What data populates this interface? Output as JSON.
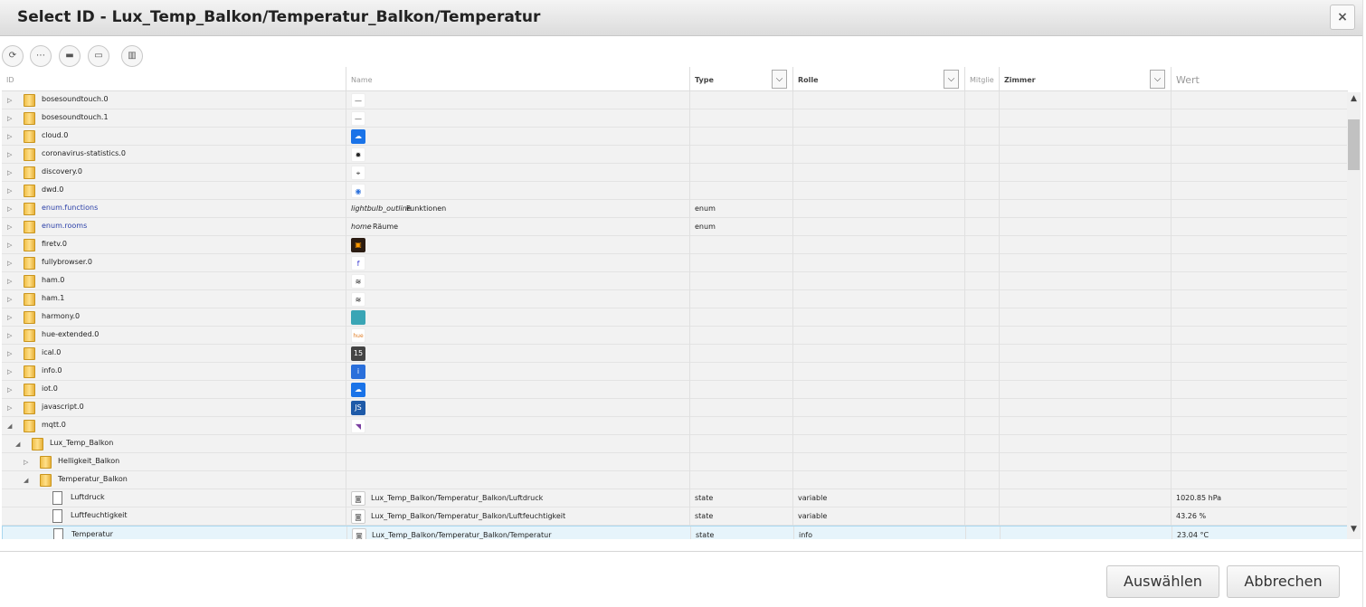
{
  "dialog": {
    "title": "Select ID - Lux_Temp_Balkon/Temperatur_Balkon/Temperatur",
    "close_label": "×",
    "select_label": "Auswählen",
    "cancel_label": "Abbrechen"
  },
  "toolbar": {
    "buttons": [
      {
        "name": "refresh-icon",
        "glyph": "⟳"
      },
      {
        "name": "list-icon",
        "glyph": "⋯"
      },
      {
        "name": "folder-collapse-icon",
        "glyph": "▬"
      },
      {
        "name": "folder-expand-icon",
        "glyph": "▭"
      },
      {
        "name": "columns-icon",
        "glyph": "▥"
      }
    ]
  },
  "columns": {
    "id": "ID",
    "name": "Name",
    "type": "Type",
    "rolle": "Rolle",
    "mitglieder": "Mitglie",
    "zimmer": "Zimmer",
    "wert": "Wert",
    "dropdown_glyph": "⌵"
  },
  "rows": [
    {
      "id": "bosesoundtouch.0",
      "level": 0,
      "kind": "folder",
      "toggle": "▷",
      "icon": {
        "bg": "#ffffff",
        "glyph": "—",
        "fg": "#444"
      }
    },
    {
      "id": "bosesoundtouch.1",
      "level": 0,
      "kind": "folder",
      "toggle": "▷",
      "icon": {
        "bg": "#ffffff",
        "glyph": "—",
        "fg": "#444"
      }
    },
    {
      "id": "cloud.0",
      "level": 0,
      "kind": "folder",
      "toggle": "▷",
      "icon": {
        "bg": "#1a73e8",
        "glyph": "☁",
        "fg": "#fff"
      }
    },
    {
      "id": "coronavirus-statistics.0",
      "level": 0,
      "kind": "folder",
      "toggle": "▷",
      "icon": {
        "bg": "#ffffff",
        "glyph": "✹",
        "fg": "#222"
      }
    },
    {
      "id": "discovery.0",
      "level": 0,
      "kind": "folder",
      "toggle": "▷",
      "icon": {
        "bg": "#ffffff",
        "glyph": "⌖",
        "fg": "#333"
      }
    },
    {
      "id": "dwd.0",
      "level": 0,
      "kind": "folder",
      "toggle": "▷",
      "icon": {
        "bg": "#ffffff",
        "glyph": "◉",
        "fg": "#2a6fdb"
      }
    },
    {
      "id": "enum.functions",
      "level": 0,
      "kind": "folder",
      "toggle": "▷",
      "enum": true,
      "name_icon": "lightbulb_outline",
      "name": "Funktionen",
      "type": "enum"
    },
    {
      "id": "enum.rooms",
      "level": 0,
      "kind": "folder",
      "toggle": "▷",
      "enum": true,
      "name_icon": "home",
      "name": "Räume",
      "type": "enum"
    },
    {
      "id": "firetv.0",
      "level": 0,
      "kind": "folder",
      "toggle": "▷",
      "icon": {
        "bg": "#2b1c12",
        "glyph": "▣",
        "fg": "#f90"
      }
    },
    {
      "id": "fullybrowser.0",
      "level": 0,
      "kind": "folder",
      "toggle": "▷",
      "icon": {
        "bg": "#ffffff",
        "glyph": "f",
        "fg": "#3a3ad0"
      }
    },
    {
      "id": "ham.0",
      "level": 0,
      "kind": "folder",
      "toggle": "▷",
      "icon": {
        "bg": "#ffffff",
        "glyph": "≋",
        "fg": "#222"
      }
    },
    {
      "id": "ham.1",
      "level": 0,
      "kind": "folder",
      "toggle": "▷",
      "icon": {
        "bg": "#ffffff",
        "glyph": "≋",
        "fg": "#222"
      }
    },
    {
      "id": "harmony.0",
      "level": 0,
      "kind": "folder",
      "toggle": "▷",
      "icon": {
        "bg": "#3aa5b5",
        "glyph": "",
        "fg": "#fff"
      }
    },
    {
      "id": "hue-extended.0",
      "level": 0,
      "kind": "folder",
      "toggle": "▷",
      "icon": {
        "bg": "#ffffff",
        "glyph": "hue",
        "fg": "#e07a20"
      }
    },
    {
      "id": "ical.0",
      "level": 0,
      "kind": "folder",
      "toggle": "▷",
      "icon": {
        "bg": "#444",
        "glyph": "15",
        "fg": "#fff"
      }
    },
    {
      "id": "info.0",
      "level": 0,
      "kind": "folder",
      "toggle": "▷",
      "icon": {
        "bg": "#2a6fdb",
        "glyph": "i",
        "fg": "#fff"
      }
    },
    {
      "id": "iot.0",
      "level": 0,
      "kind": "folder",
      "toggle": "▷",
      "icon": {
        "bg": "#1a73e8",
        "glyph": "☁",
        "fg": "#fff"
      }
    },
    {
      "id": "javascript.0",
      "level": 0,
      "kind": "folder",
      "toggle": "▷",
      "icon": {
        "bg": "#1e5aa8",
        "glyph": "JS",
        "fg": "#fff"
      }
    },
    {
      "id": "mqtt.0",
      "level": 0,
      "kind": "folder",
      "toggle": "◢",
      "icon": {
        "bg": "#ffffff",
        "glyph": "◥",
        "fg": "#7b3fa0"
      }
    },
    {
      "id": "Lux_Temp_Balkon",
      "level": 1,
      "kind": "folder",
      "toggle": "◢"
    },
    {
      "id": "Helligkeit_Balkon",
      "level": 2,
      "kind": "folder",
      "toggle": "▷"
    },
    {
      "id": "Temperatur_Balkon",
      "level": 2,
      "kind": "folder",
      "toggle": "◢"
    },
    {
      "id": "Luftdruck",
      "level": 3,
      "kind": "file",
      "state_icon": "◙",
      "name": "Lux_Temp_Balkon/Temperatur_Balkon/Luftdruck",
      "type": "state",
      "role": "variable",
      "value": "1020.85 hPa"
    },
    {
      "id": "Luftfeuchtigkeit",
      "level": 3,
      "kind": "file",
      "state_icon": "◙",
      "name": "Lux_Temp_Balkon/Temperatur_Balkon/Luftfeuchtigkeit",
      "type": "state",
      "role": "variable",
      "value": "43.26 %"
    },
    {
      "id": "Temperatur",
      "level": 3,
      "kind": "file",
      "state_icon": "◙",
      "name": "Lux_Temp_Balkon/Temperatur_Balkon/Temperatur",
      "type": "state",
      "role": "info",
      "value": "23.04 °C",
      "selected": true
    }
  ],
  "scrollbar": {
    "up": "▲",
    "down": "▼"
  }
}
